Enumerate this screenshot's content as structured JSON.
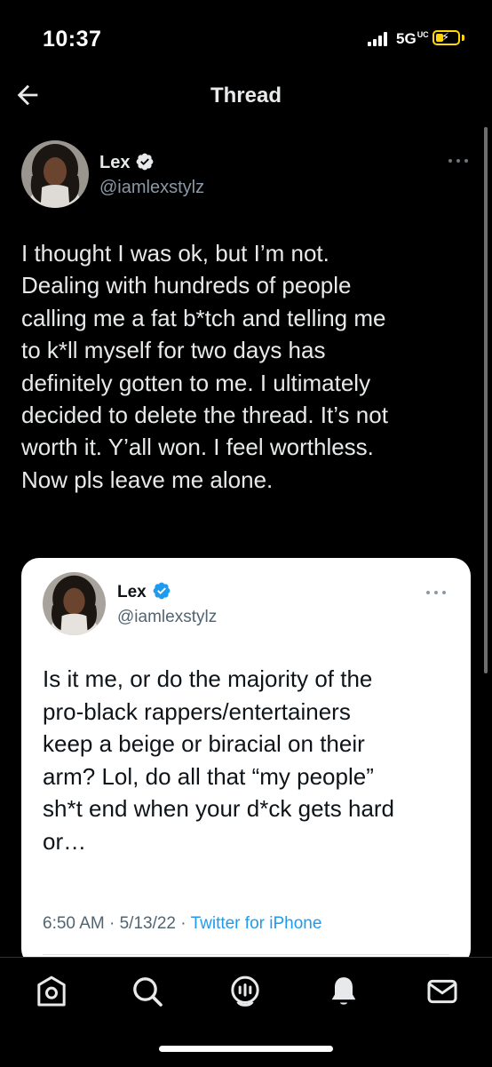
{
  "status_bar": {
    "time": "10:37",
    "network": "5G",
    "network_sup": "UC",
    "battery_level": 0.35,
    "battery_color": "#ffd60a"
  },
  "header": {
    "title": "Thread",
    "back_icon": "arrow-left-icon"
  },
  "tweet": {
    "author_name": "Lex",
    "author_handle": "@iamlexstylz",
    "verified": true,
    "text": "I thought I was ok, but I’m not.\nDealing with hundreds of people\ncalling me a fat b*tch and telling me\nto k*ll myself for two days has\ndefinitely gotten to me. I ultimately\ndecided to delete the thread. It’s not\nworth it. Y’all won. I feel worthless.\nNow pls leave me alone."
  },
  "quoted_tweet": {
    "author_name": "Lex",
    "author_handle": "@iamlexstylz",
    "verified": true,
    "text": "Is it me, or do the majority of the\npro-black rappers/entertainers\nkeep a beige or biracial on their\narm? Lol, do all that “my people”\nsh*t end when your d*ck gets hard\nor…",
    "time": "6:50 AM",
    "date": "5/13/22",
    "source": "Twitter for iPhone",
    "separator": " · "
  },
  "bottom_nav": {
    "items": [
      "home-icon",
      "search-icon",
      "spaces-icon",
      "notifications-icon",
      "messages-icon"
    ]
  },
  "colors": {
    "background": "#000000",
    "text": "#e7e9ea",
    "secondary_text": "#8b98a5",
    "accent": "#1d9bf0",
    "card_background": "#ffffff"
  }
}
